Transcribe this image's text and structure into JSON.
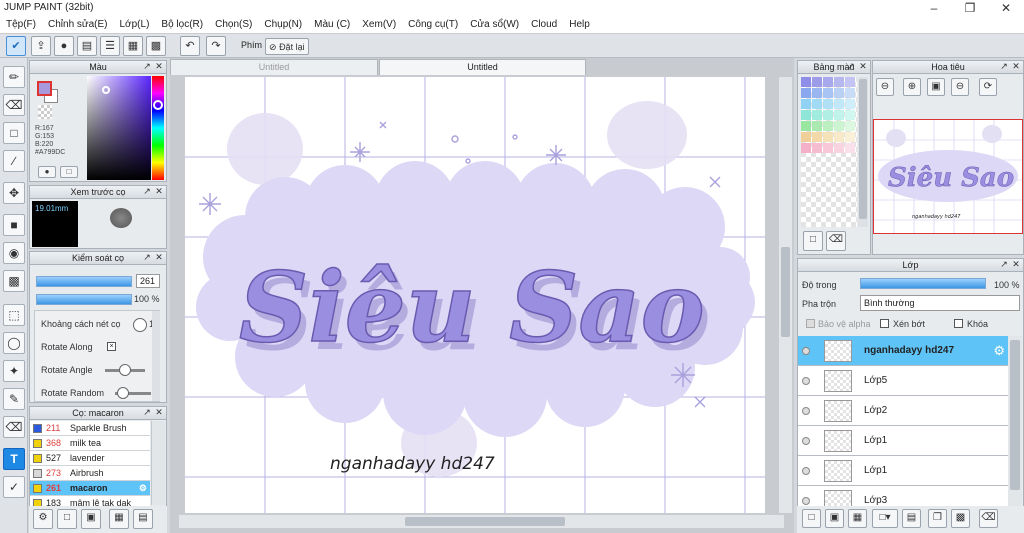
{
  "app": {
    "title": "JUMP PAINT (32bit)"
  },
  "menu": [
    "Tệp(F)",
    "Chỉnh sửa(E)",
    "Lớp(L)",
    "Bộ lọc(R)",
    "Chọn(S)",
    "Chụp(N)",
    "Màu (C)",
    "Xem(V)",
    "Công cụ(T)",
    "Cửa sổ(W)",
    "Cloud",
    "Help"
  ],
  "toolbar": {
    "phim": "Phím",
    "reset": "Đặt lại"
  },
  "color_panel": {
    "title": "Màu",
    "r": "R:167",
    "g": "G:153",
    "b": "B:220",
    "hex": "#A799DC",
    "fg": "#A799DC"
  },
  "brush_preview": {
    "title": "Xem trước cọ",
    "size": "19.01mm"
  },
  "brush_control": {
    "title": "Kiểm soát cọ",
    "size": "261",
    "opacity": "100 %",
    "spacing": "Khoảng cách nét cọ",
    "spacing_val": "1",
    "rotate_along": "Rotate Along",
    "rotate_angle": "Rotate Angle",
    "rotate_random": "Rotate Random"
  },
  "brushes": {
    "title": "Cọ: macaron",
    "items": [
      {
        "num": "211",
        "name": "Sparkle Brush",
        "color": "#2a5adf",
        "numcolor": "#e04040"
      },
      {
        "num": "368",
        "name": "milk tea",
        "color": "#f1d20a",
        "numcolor": "#e04040"
      },
      {
        "num": "527",
        "name": "lavender",
        "color": "#f1d20a",
        "numcolor": "#222222"
      },
      {
        "num": "273",
        "name": "Airbrush",
        "color": "#d8d8d8",
        "numcolor": "#e04040"
      },
      {
        "num": "261",
        "name": "macaron",
        "color": "#f1d20a",
        "numcolor": "#e04040"
      },
      {
        "num": "183",
        "name": "mâm lê tak dak",
        "color": "#f1d20a",
        "numcolor": "#222222"
      }
    ]
  },
  "tabs": [
    "Untitled",
    "Untitled"
  ],
  "canvas": {
    "title_text": "Siêu Sao",
    "sub_text": "nganhadayy hd247"
  },
  "palette": {
    "title": "Bảng màu",
    "colors": [
      "#8e8ee8",
      "#9c9ce8",
      "#a8a8ec",
      "#b7b7f0",
      "#c4c4f4",
      "#8aa8f0",
      "#9ab6f0",
      "#a8c4f4",
      "#b8d0f4",
      "#c8dcf8",
      "#8fd2f4",
      "#a0daf4",
      "#b0e0f6",
      "#c0e8f8",
      "#d0eefa",
      "#8ee6d8",
      "#a0ecde",
      "#b0f0e4",
      "#c0f4ea",
      "#d0f8f0",
      "#98e6a0",
      "#aaeab0",
      "#bcf0c0",
      "#ccf4d0",
      "#dcf8e0",
      "#f0d098",
      "#f4daa8",
      "#f6e2b8",
      "#f8eac8",
      "#faf0d8",
      "#f4b0c8",
      "#f6bcd0",
      "#f8c8d8",
      "#f8d4e0",
      "#fae0ea"
    ]
  },
  "navigator": {
    "title": "Hoa tiêu"
  },
  "layers": {
    "title": "Lớp",
    "opacity_label": "Độ trong",
    "opacity": "100 %",
    "blend_label": "Pha trộn",
    "blend": "Bình thường",
    "alpha_lock": "Bảo vệ alpha",
    "clip": "Xén bớt",
    "lock": "Khóa",
    "items": [
      {
        "name": "nganhadayy hd247",
        "selected": true
      },
      {
        "name": "Lớp5"
      },
      {
        "name": "Lớp2"
      },
      {
        "name": "Lớp1"
      },
      {
        "name": "Lớp1"
      },
      {
        "name": "Lớp3"
      }
    ]
  }
}
